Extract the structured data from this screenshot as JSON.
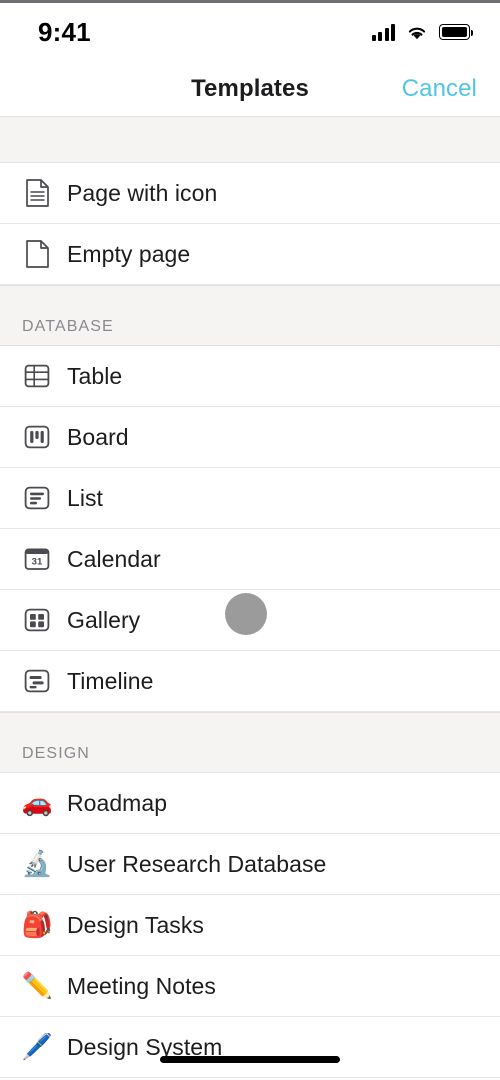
{
  "status_bar": {
    "time": "9:41",
    "signal_icon": "cellular-signal-icon",
    "wifi_icon": "wifi-icon",
    "battery_icon": "battery-full-icon"
  },
  "nav": {
    "title": "Templates",
    "cancel_label": "Cancel",
    "cancel_color": "#51c6e3"
  },
  "sections": [
    {
      "header": "",
      "rows": [
        {
          "label": "Page with icon",
          "icon": "document-lines-icon",
          "icon_type": "svg"
        },
        {
          "label": "Empty page",
          "icon": "document-blank-icon",
          "icon_type": "svg"
        }
      ]
    },
    {
      "header": "DATABASE",
      "rows": [
        {
          "label": "Table",
          "icon": "table-grid-icon",
          "icon_type": "svg"
        },
        {
          "label": "Board",
          "icon": "board-columns-icon",
          "icon_type": "svg"
        },
        {
          "label": "List",
          "icon": "list-lines-icon",
          "icon_type": "svg"
        },
        {
          "label": "Calendar",
          "icon": "calendar-31-icon",
          "icon_type": "svg",
          "icon_text": "31"
        },
        {
          "label": "Gallery",
          "icon": "gallery-grid-icon",
          "icon_type": "svg"
        },
        {
          "label": "Timeline",
          "icon": "timeline-bars-icon",
          "icon_type": "svg"
        }
      ]
    },
    {
      "header": "DESIGN",
      "rows": [
        {
          "label": "Roadmap",
          "icon": "car-emoji",
          "icon_type": "emoji",
          "glyph": "🚗"
        },
        {
          "label": "User Research Database",
          "icon": "microscope-emoji",
          "icon_type": "emoji",
          "glyph": "🔬"
        },
        {
          "label": "Design Tasks",
          "icon": "backpack-emoji",
          "icon_type": "emoji",
          "glyph": "🎒"
        },
        {
          "label": "Meeting Notes",
          "icon": "pencil-emoji",
          "icon_type": "emoji",
          "glyph": "✏️"
        },
        {
          "label": "Design System",
          "icon": "pen-emoji",
          "icon_type": "emoji",
          "glyph": "🖊️"
        }
      ]
    }
  ],
  "touch_indicator": {
    "name": "touch-point-indicator",
    "color": "#9b9b9b"
  },
  "home_indicator": {
    "name": "home-indicator"
  }
}
